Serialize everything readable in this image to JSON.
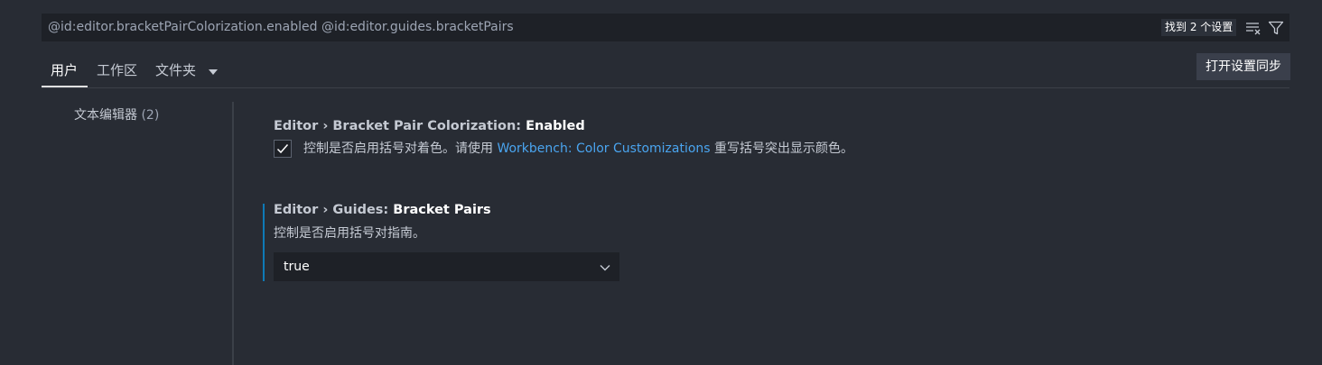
{
  "search": {
    "query": "@id:editor.bracketPairColorization.enabled @id:editor.guides.bracketPairs",
    "result_count": "找到 2 个设置",
    "clear_icon": "clear-filter-icon",
    "filter_icon": "filter-icon"
  },
  "tabs": [
    {
      "label": "用户",
      "active": true
    },
    {
      "label": "工作区",
      "active": false
    },
    {
      "label": "文件夹",
      "active": false,
      "dropdown": true
    }
  ],
  "sync_button": "打开设置同步",
  "toc": [
    {
      "label": "文本编辑器",
      "count": "(2)"
    }
  ],
  "settings": [
    {
      "category": "Editor › Bracket Pair Colorization: ",
      "name": "Enabled",
      "checked": true,
      "description_before": "控制是否启用括号对着色。请使用 ",
      "link": "Workbench: Color Customizations",
      "description_after": " 重写括号突出显示颜色。"
    },
    {
      "category": "Editor › Guides: ",
      "name": "Bracket Pairs",
      "description": "控制是否启用括号对指南。",
      "value": "true"
    }
  ],
  "colors": {
    "background": "#282c34",
    "input_background": "#1e2127",
    "link": "#4aa5f0",
    "focus_bar": "#0e7ab6"
  }
}
